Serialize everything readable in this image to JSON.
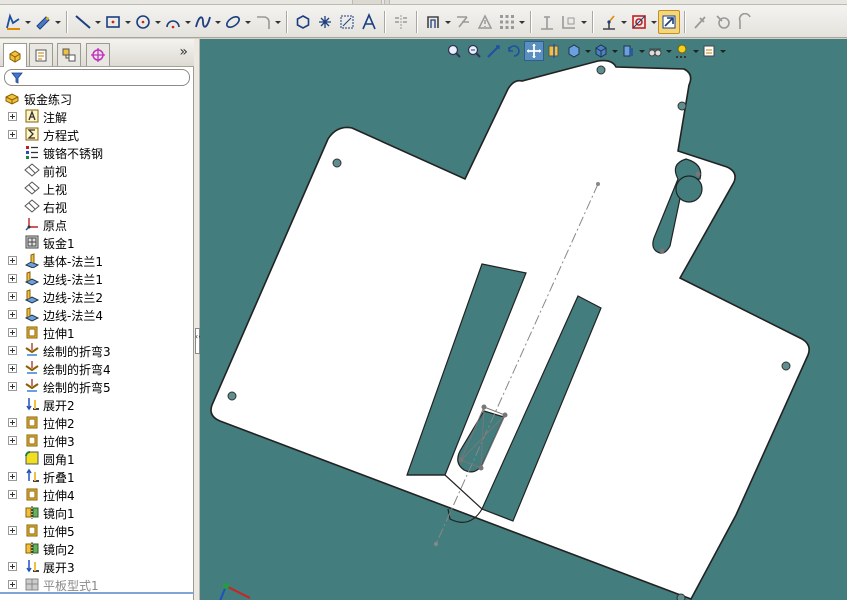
{
  "feature_tree": {
    "root": {
      "label": "钣金练习",
      "icon": "part-icon"
    },
    "items": [
      {
        "label": "注解",
        "icon": "annotations-icon",
        "expandable": true,
        "disabled": false
      },
      {
        "label": "方程式",
        "icon": "equations-icon",
        "expandable": true,
        "disabled": false
      },
      {
        "label": "镀铬不锈钢",
        "icon": "material-icon",
        "expandable": false,
        "disabled": false
      },
      {
        "label": "前视",
        "icon": "plane-icon",
        "expandable": false,
        "disabled": false
      },
      {
        "label": "上视",
        "icon": "plane-icon",
        "expandable": false,
        "disabled": false
      },
      {
        "label": "右视",
        "icon": "plane-icon",
        "expandable": false,
        "disabled": false
      },
      {
        "label": "原点",
        "icon": "origin-icon",
        "expandable": false,
        "disabled": false
      },
      {
        "label": "钣金1",
        "icon": "sheet-metal-icon",
        "expandable": false,
        "disabled": false
      },
      {
        "label": "基体-法兰1",
        "icon": "base-flange-icon",
        "expandable": true,
        "disabled": false
      },
      {
        "label": "边线-法兰1",
        "icon": "edge-flange-icon",
        "expandable": true,
        "disabled": false
      },
      {
        "label": "边线-法兰2",
        "icon": "edge-flange-icon",
        "expandable": true,
        "disabled": false
      },
      {
        "label": "边线-法兰4",
        "icon": "edge-flange-icon",
        "expandable": true,
        "disabled": false
      },
      {
        "label": "拉伸1",
        "icon": "extrude-icon",
        "expandable": true,
        "disabled": false
      },
      {
        "label": "绘制的折弯3",
        "icon": "sketched-bend-icon",
        "expandable": true,
        "disabled": false
      },
      {
        "label": "绘制的折弯4",
        "icon": "sketched-bend-icon",
        "expandable": true,
        "disabled": false
      },
      {
        "label": "绘制的折弯5",
        "icon": "sketched-bend-icon",
        "expandable": true,
        "disabled": false
      },
      {
        "label": "展开2",
        "icon": "unfold-icon",
        "expandable": false,
        "disabled": false
      },
      {
        "label": "拉伸2",
        "icon": "extrude-icon",
        "expandable": true,
        "disabled": false
      },
      {
        "label": "拉伸3",
        "icon": "extrude-icon",
        "expandable": true,
        "disabled": false
      },
      {
        "label": "圆角1",
        "icon": "fillet-icon",
        "expandable": false,
        "disabled": false
      },
      {
        "label": "折叠1",
        "icon": "fold-icon",
        "expandable": true,
        "disabled": false
      },
      {
        "label": "拉伸4",
        "icon": "extrude-icon",
        "expandable": true,
        "disabled": false
      },
      {
        "label": "镜向1",
        "icon": "mirror-icon",
        "expandable": false,
        "disabled": false
      },
      {
        "label": "拉伸5",
        "icon": "extrude-icon",
        "expandable": true,
        "disabled": false
      },
      {
        "label": "镜向2",
        "icon": "mirror-icon",
        "expandable": false,
        "disabled": false
      },
      {
        "label": "展开3",
        "icon": "unfold-icon",
        "expandable": true,
        "disabled": false
      },
      {
        "label": "平板型式1",
        "icon": "flat-pattern-icon",
        "expandable": true,
        "disabled": true
      }
    ]
  },
  "left_tabs": [
    "featuremanager-tab",
    "propertymanager-tab",
    "configurationmanager-tab",
    "dimxpert-tab"
  ],
  "more_glyph": "»",
  "colors": {
    "viewport": "#437d7e",
    "part": "#ffffff",
    "sketch_line": "#888888",
    "selected_button": "#f5d77a"
  },
  "toolbar_icons": [
    "smart-dimension-icon",
    "sketch-icon",
    "line-icon",
    "rectangle-icon",
    "circle-icon",
    "arc-icon",
    "spline-icon",
    "ellipse-icon",
    "fillet-sketch-icon",
    "polygon-icon",
    "point-icon",
    "convert-entities-icon",
    "text-icon",
    "mirror-entities-icon",
    "offset-entities-icon",
    "trim-icon",
    "pattern-icon",
    "relations-icon",
    "display-relations-icon",
    "repair-sketch-icon",
    "quick-snaps-icon",
    "rapid-sketch-icon",
    "instant2d-icon",
    "sheet-metal-tools-icon"
  ],
  "view_tools": [
    "zoom-to-fit-icon",
    "zoom-to-area-icon",
    "previous-view-icon",
    "rotate-icon",
    "pan-icon",
    "section-view-icon",
    "view-orientation-icon",
    "display-style-icon",
    "hide-show-icon",
    "edit-appearance-icon",
    "apply-scene-icon",
    "view-settings-icon"
  ]
}
